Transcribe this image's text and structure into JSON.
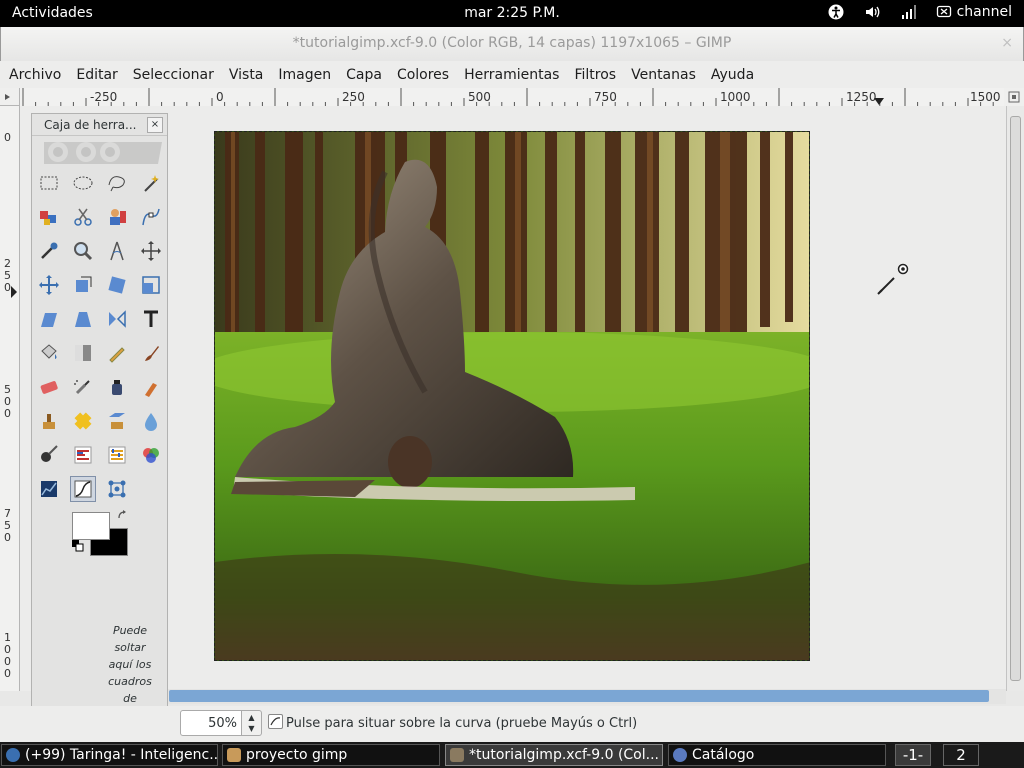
{
  "topbar": {
    "activities": "Actividades",
    "clock": "mar  2:25 P.M.",
    "user": "channel"
  },
  "window": {
    "title": "*tutorialgimp.xcf-9.0 (Color RGB, 14 capas) 1197x1065 – GIMP",
    "close": "×"
  },
  "menu": [
    "Archivo",
    "Editar",
    "Seleccionar",
    "Vista",
    "Imagen",
    "Capa",
    "Colores",
    "Herramientas",
    "Filtros",
    "Ventanas",
    "Ayuda"
  ],
  "ruler": {
    "h_labels": [
      "-250",
      "0",
      "250",
      "500",
      "750",
      "1000",
      "1250",
      "1500"
    ],
    "v_labels": [
      "0",
      "250",
      "500",
      "750",
      "1000"
    ]
  },
  "toolbox": {
    "title": "Caja de herra...",
    "close": "×",
    "drop_note": "Puede soltar aquí los cuadros de diálogo",
    "tools": [
      "rect-select-tool",
      "ellipse-select-tool",
      "free-select-tool",
      "fuzzy-select-tool",
      "select-by-color-tool",
      "scissors-select-tool",
      "foreground-select-tool",
      "paths-tool",
      "color-picker-tool",
      "zoom-tool",
      "measure-tool",
      "move-tool",
      "align-tool",
      "transform-tool",
      "rotate-tool",
      "scale-tool",
      "shear-tool",
      "perspective-tool",
      "flip-tool",
      "text-tool",
      "bucket-fill-tool",
      "blend-tool",
      "pencil-tool",
      "paintbrush-tool",
      "eraser-tool",
      "airbrush-tool",
      "ink-tool",
      "mypaint-brush-tool",
      "clone-tool",
      "heal-tool",
      "perspective-clone-tool",
      "blur-tool",
      "smudge-tool",
      "dodge-burn-tool",
      "levels-tool",
      "color-balance-tool",
      "curves-tool",
      "threshold-tool",
      "cage-transform-tool"
    ],
    "selected_tool": "threshold-tool",
    "fg_color": "#ffffff",
    "bg_color": "#000000"
  },
  "status": {
    "zoom": "50%",
    "message": "Pulse para situar sobre la curva (pruebe Mayús o Ctrl)"
  },
  "taskbar": {
    "tasks": [
      {
        "label": "(+99) Taringa! - Inteligenc...",
        "active": false
      },
      {
        "label": "proyecto gimp",
        "active": false
      },
      {
        "label": "*tutorialgimp.xcf-9.0 (Col...",
        "active": true
      },
      {
        "label": "Catálogo",
        "active": false
      }
    ],
    "workspace_prev": "-1-",
    "workspace_next": "2"
  }
}
